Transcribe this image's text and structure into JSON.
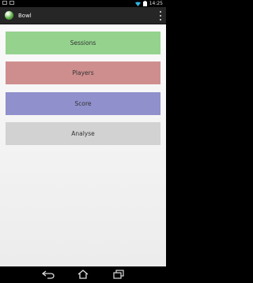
{
  "status_bar": {
    "time": "14:25"
  },
  "action_bar": {
    "title": "Bowl",
    "overflow_icon": "overflow-menu-icon"
  },
  "menu": {
    "sessions_label": "Sessions",
    "players_label": "Players",
    "score_label": "Score",
    "analyse_label": "Analyse"
  },
  "colors": {
    "sessions": "#94d28e",
    "players": "#cf8e8e",
    "score": "#9090cc",
    "analyse": "#d2d2d2"
  },
  "navigation": {
    "back_icon": "back-icon",
    "home_icon": "home-icon",
    "recent_icon": "recent-apps-icon"
  }
}
